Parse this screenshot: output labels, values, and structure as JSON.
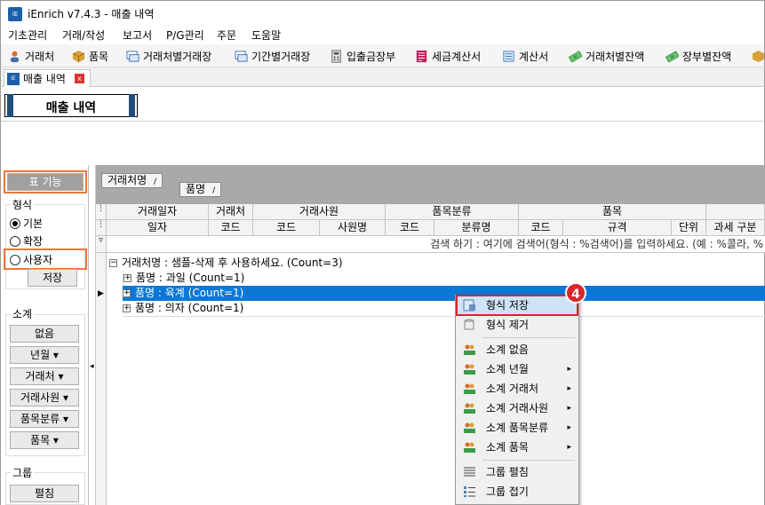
{
  "window": {
    "title": "iEnrich v7.4.3 - 매출 내역",
    "app_icon_text": "iEnrich"
  },
  "menu": [
    "기초관리",
    "거래/작성",
    "보고서",
    "P/G관리",
    "주문",
    "도움말"
  ],
  "toolbar": [
    {
      "label": "거래처",
      "icon": "person-icon",
      "color": "#d66b2c"
    },
    {
      "label": "품목",
      "icon": "box-icon",
      "color": "#d9a13a"
    },
    {
      "label": "거래처별거래장",
      "icon": "ledger-icon",
      "color": "#3a6fb5"
    },
    {
      "label": "기간별거래장",
      "icon": "ledger-icon",
      "color": "#3a6fb5"
    },
    {
      "label": "입출금장부",
      "icon": "calculator-icon",
      "color": "#555555"
    },
    {
      "label": "세금계산서",
      "icon": "tax-invoice-icon",
      "color": "#c2185b"
    },
    {
      "label": "계산서",
      "icon": "invoice-icon",
      "color": "#4a7fb5"
    },
    {
      "label": "거래처별잔액",
      "icon": "money-icon",
      "color": "#3e9a4a"
    },
    {
      "label": "장부별잔액",
      "icon": "money-icon",
      "color": "#3e9a4a"
    }
  ],
  "doc_tab": {
    "label": "매출 내역",
    "close": "x"
  },
  "page_title": "매출 내역",
  "left_panel": {
    "table_features_button": "표 기능",
    "format_label": "형식",
    "format_options": [
      {
        "label": "기본",
        "selected": true
      },
      {
        "label": "확장",
        "selected": false
      },
      {
        "label": "사용자",
        "selected": false
      }
    ],
    "save_button": "저장",
    "subtotal_label": "소계",
    "subtotal_buttons": [
      "없음",
      "년월 ▾",
      "거래처 ▾",
      "거래사원 ▾",
      "품목분류 ▾",
      "품목 ▾"
    ],
    "group_label": "그룹",
    "group_expand_button": "펼침"
  },
  "grid": {
    "group_chips": [
      {
        "label": "거래처명",
        "sort": "/"
      },
      {
        "label": "품명",
        "sort": "/"
      }
    ],
    "header_top": [
      "거래일자",
      "거래처",
      "거래사원",
      "품목분류",
      "품목",
      ""
    ],
    "header_bottom": [
      "일자",
      "코드",
      "코드",
      "사원명",
      "코드",
      "분류명",
      "코드",
      "규격",
      "단위",
      "과세 구분"
    ],
    "filter_text": "검색 하기 : 여기에 검색어(형식 : %검색어)를 입력하세요. (예 : %콜라, %",
    "group_rows": [
      {
        "text": "거래처명 : 샘플-삭제 후 사용하세요. (Count=3)",
        "expander": "−"
      },
      {
        "text": "품명 : 과일 (Count=1)",
        "expander": "+"
      },
      {
        "text": "품명 : 육계 (Count=1)",
        "expander": "+"
      },
      {
        "text": "품명 : 의자 (Count=1)",
        "expander": "+"
      }
    ]
  },
  "context_menu": {
    "items": [
      {
        "label": "형식 저장",
        "icon": "save-format-icon",
        "submenu": false,
        "highlighted": true
      },
      {
        "label": "형식 제거",
        "icon": "remove-format-icon",
        "submenu": false
      },
      {
        "label": "소계 없음",
        "icon": "people-icon",
        "submenu": false
      },
      {
        "label": "소계 년월",
        "icon": "people-icon",
        "submenu": true
      },
      {
        "label": "소계 거래처",
        "icon": "people-icon",
        "submenu": true
      },
      {
        "label": "소계 거래사원",
        "icon": "people-icon",
        "submenu": true
      },
      {
        "label": "소계 품목분류",
        "icon": "people-icon",
        "submenu": true
      },
      {
        "label": "소계 품목",
        "icon": "people-icon",
        "submenu": true
      },
      {
        "label": "그룹 펼침",
        "icon": "expand-list-icon",
        "submenu": false
      },
      {
        "label": "그룹 접기",
        "icon": "collapse-list-icon",
        "submenu": false
      }
    ],
    "submenu_arrow": "▸"
  },
  "step_badge": "4",
  "colors": {
    "selection": "#0a78d7",
    "highlight_box": "#e8783a",
    "badge": "#d9262a",
    "banner_bar": "#1f4e79"
  }
}
